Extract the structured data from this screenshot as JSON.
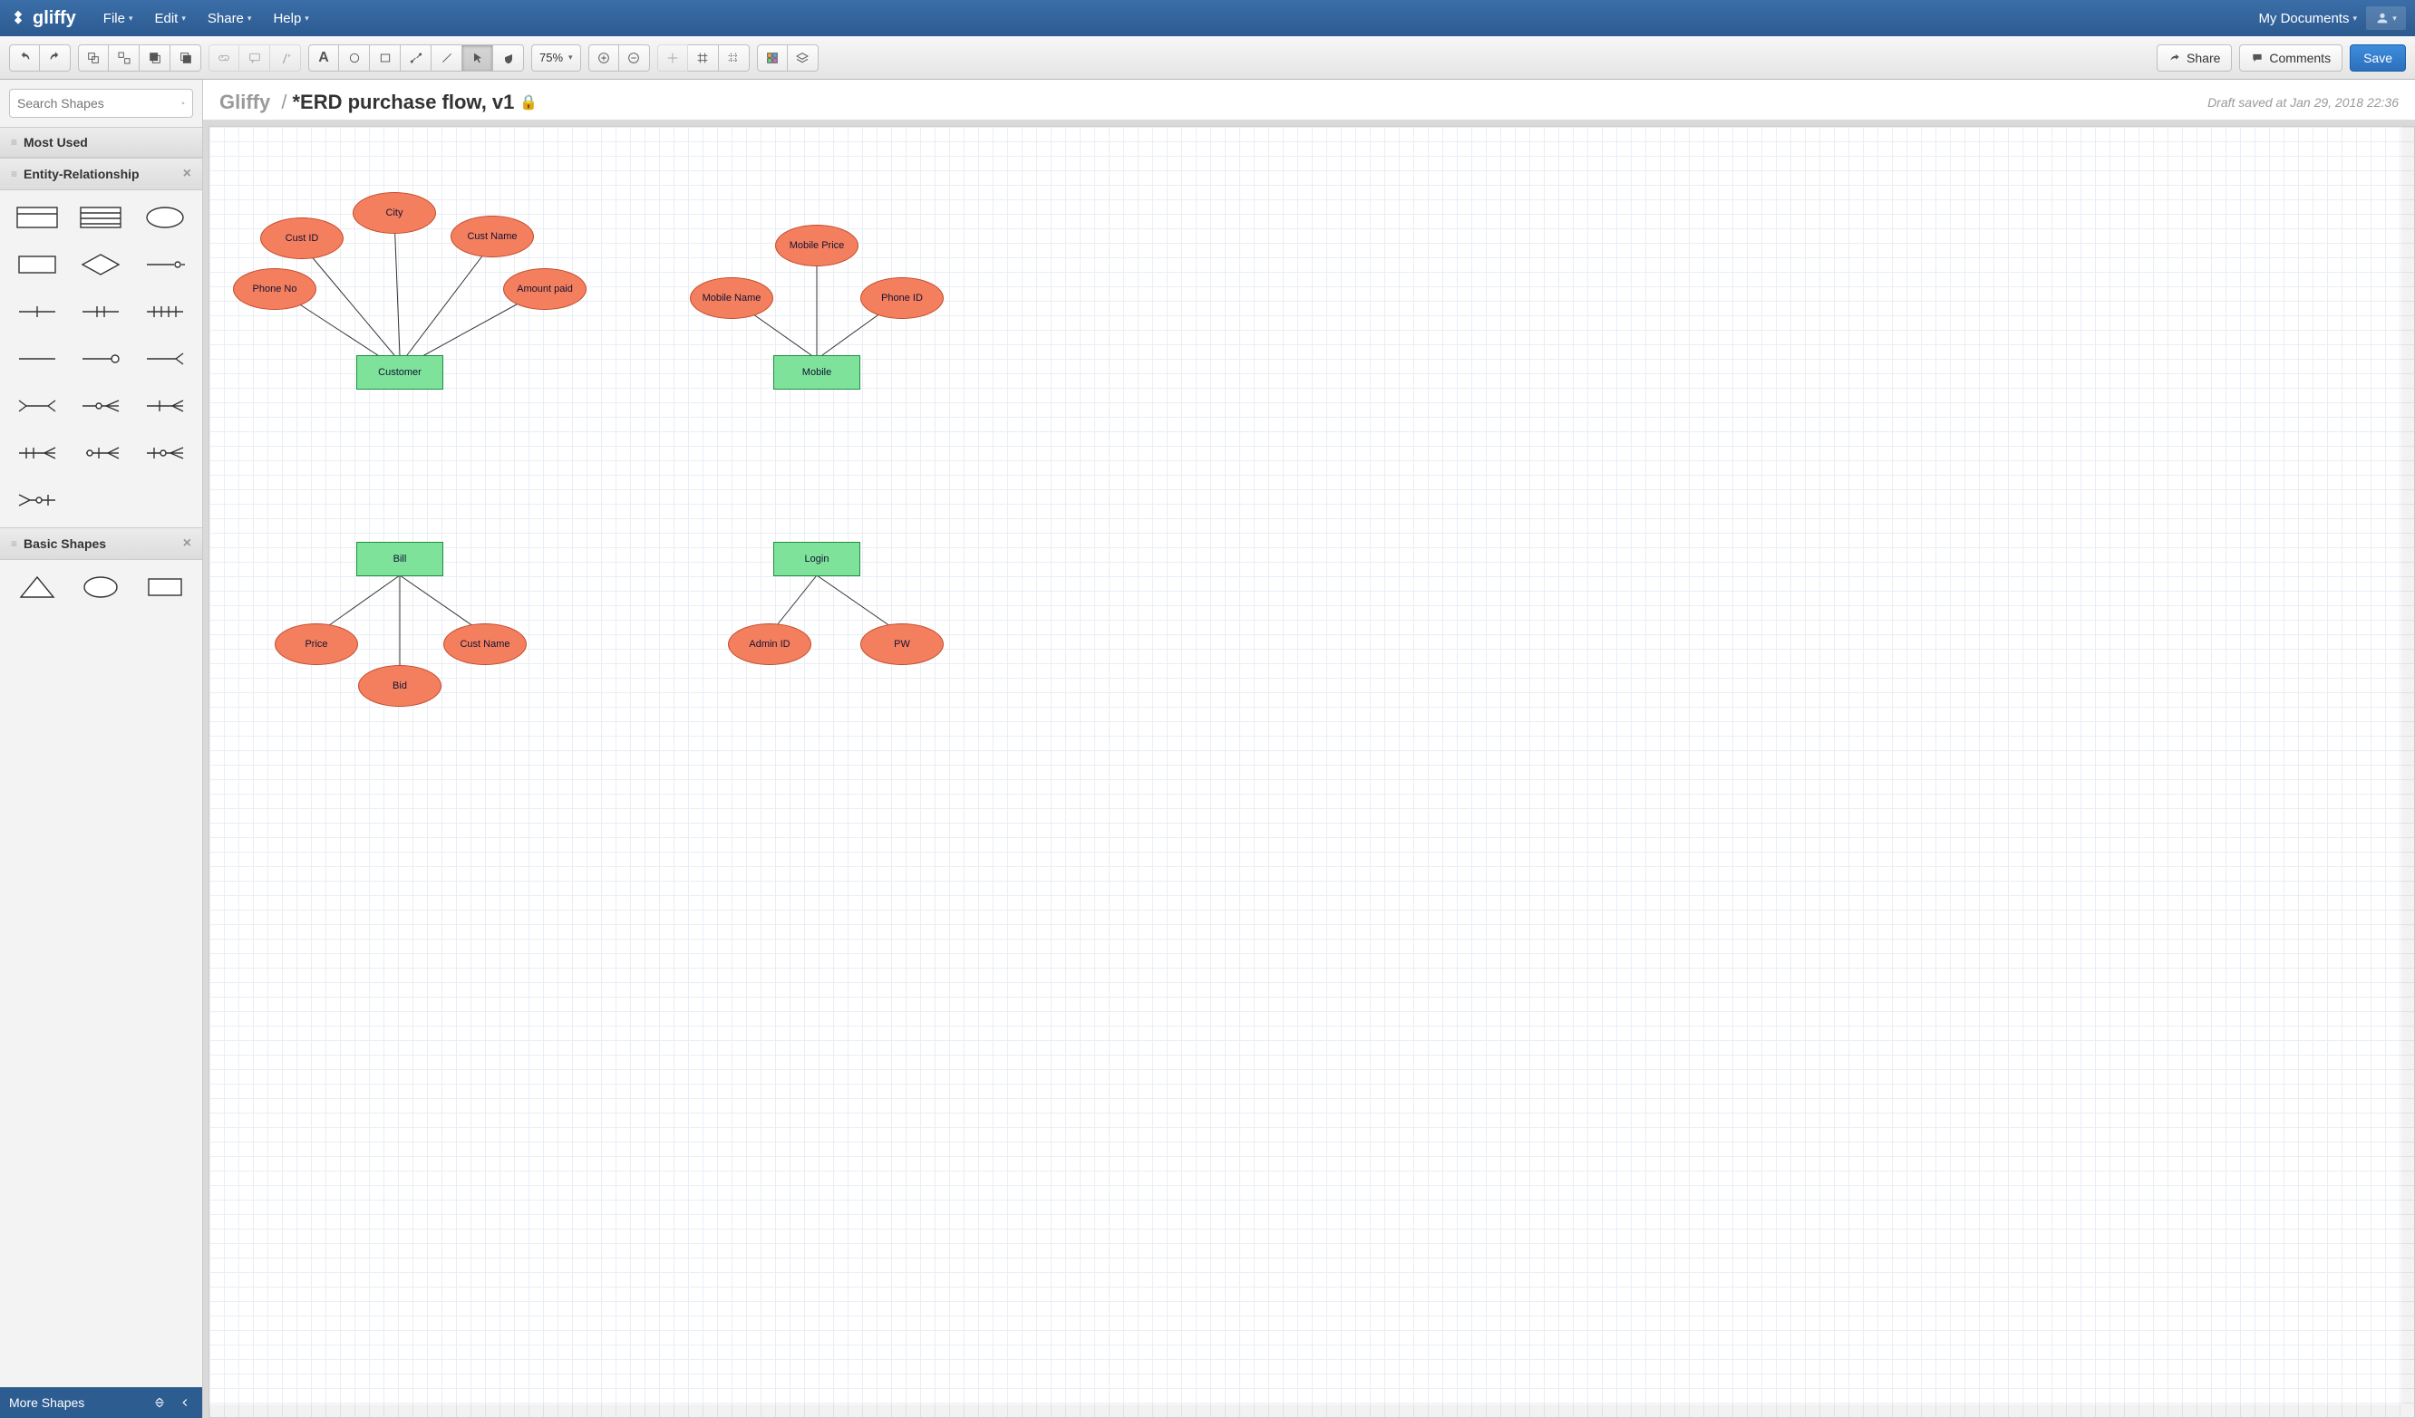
{
  "brand": "gliffy",
  "menu": {
    "items": [
      "File",
      "Edit",
      "Share",
      "Help"
    ],
    "my_documents": "My Documents"
  },
  "toolbar": {
    "zoom": "75%",
    "share": "Share",
    "comments": "Comments",
    "save": "Save"
  },
  "sidebar": {
    "search_placeholder": "Search Shapes",
    "cat_most_used": "Most Used",
    "cat_er": "Entity-Relationship",
    "cat_basic": "Basic Shapes",
    "more_shapes": "More Shapes"
  },
  "doc": {
    "breadcrumb": "Gliffy",
    "title": "*ERD purchase flow, v1",
    "draft_status": "Draft saved at Jan 29, 2018 22:36"
  },
  "diagram": {
    "customer": {
      "entity": "Customer",
      "attrs": {
        "phone_no": "Phone No",
        "cust_id": "Cust ID",
        "city": "City",
        "cust_name": "Cust Name",
        "amount_paid": "Amount paid"
      }
    },
    "mobile": {
      "entity": "Mobile",
      "attrs": {
        "mobile_name": "Mobile Name",
        "mobile_price": "Mobile Price",
        "phone_id": "Phone ID"
      }
    },
    "bill": {
      "entity": "Bill",
      "attrs": {
        "price": "Price",
        "bid": "Bid",
        "cust_name": "Cust Name"
      }
    },
    "login": {
      "entity": "Login",
      "attrs": {
        "admin_id": "Admin ID",
        "pw": "PW"
      }
    }
  }
}
